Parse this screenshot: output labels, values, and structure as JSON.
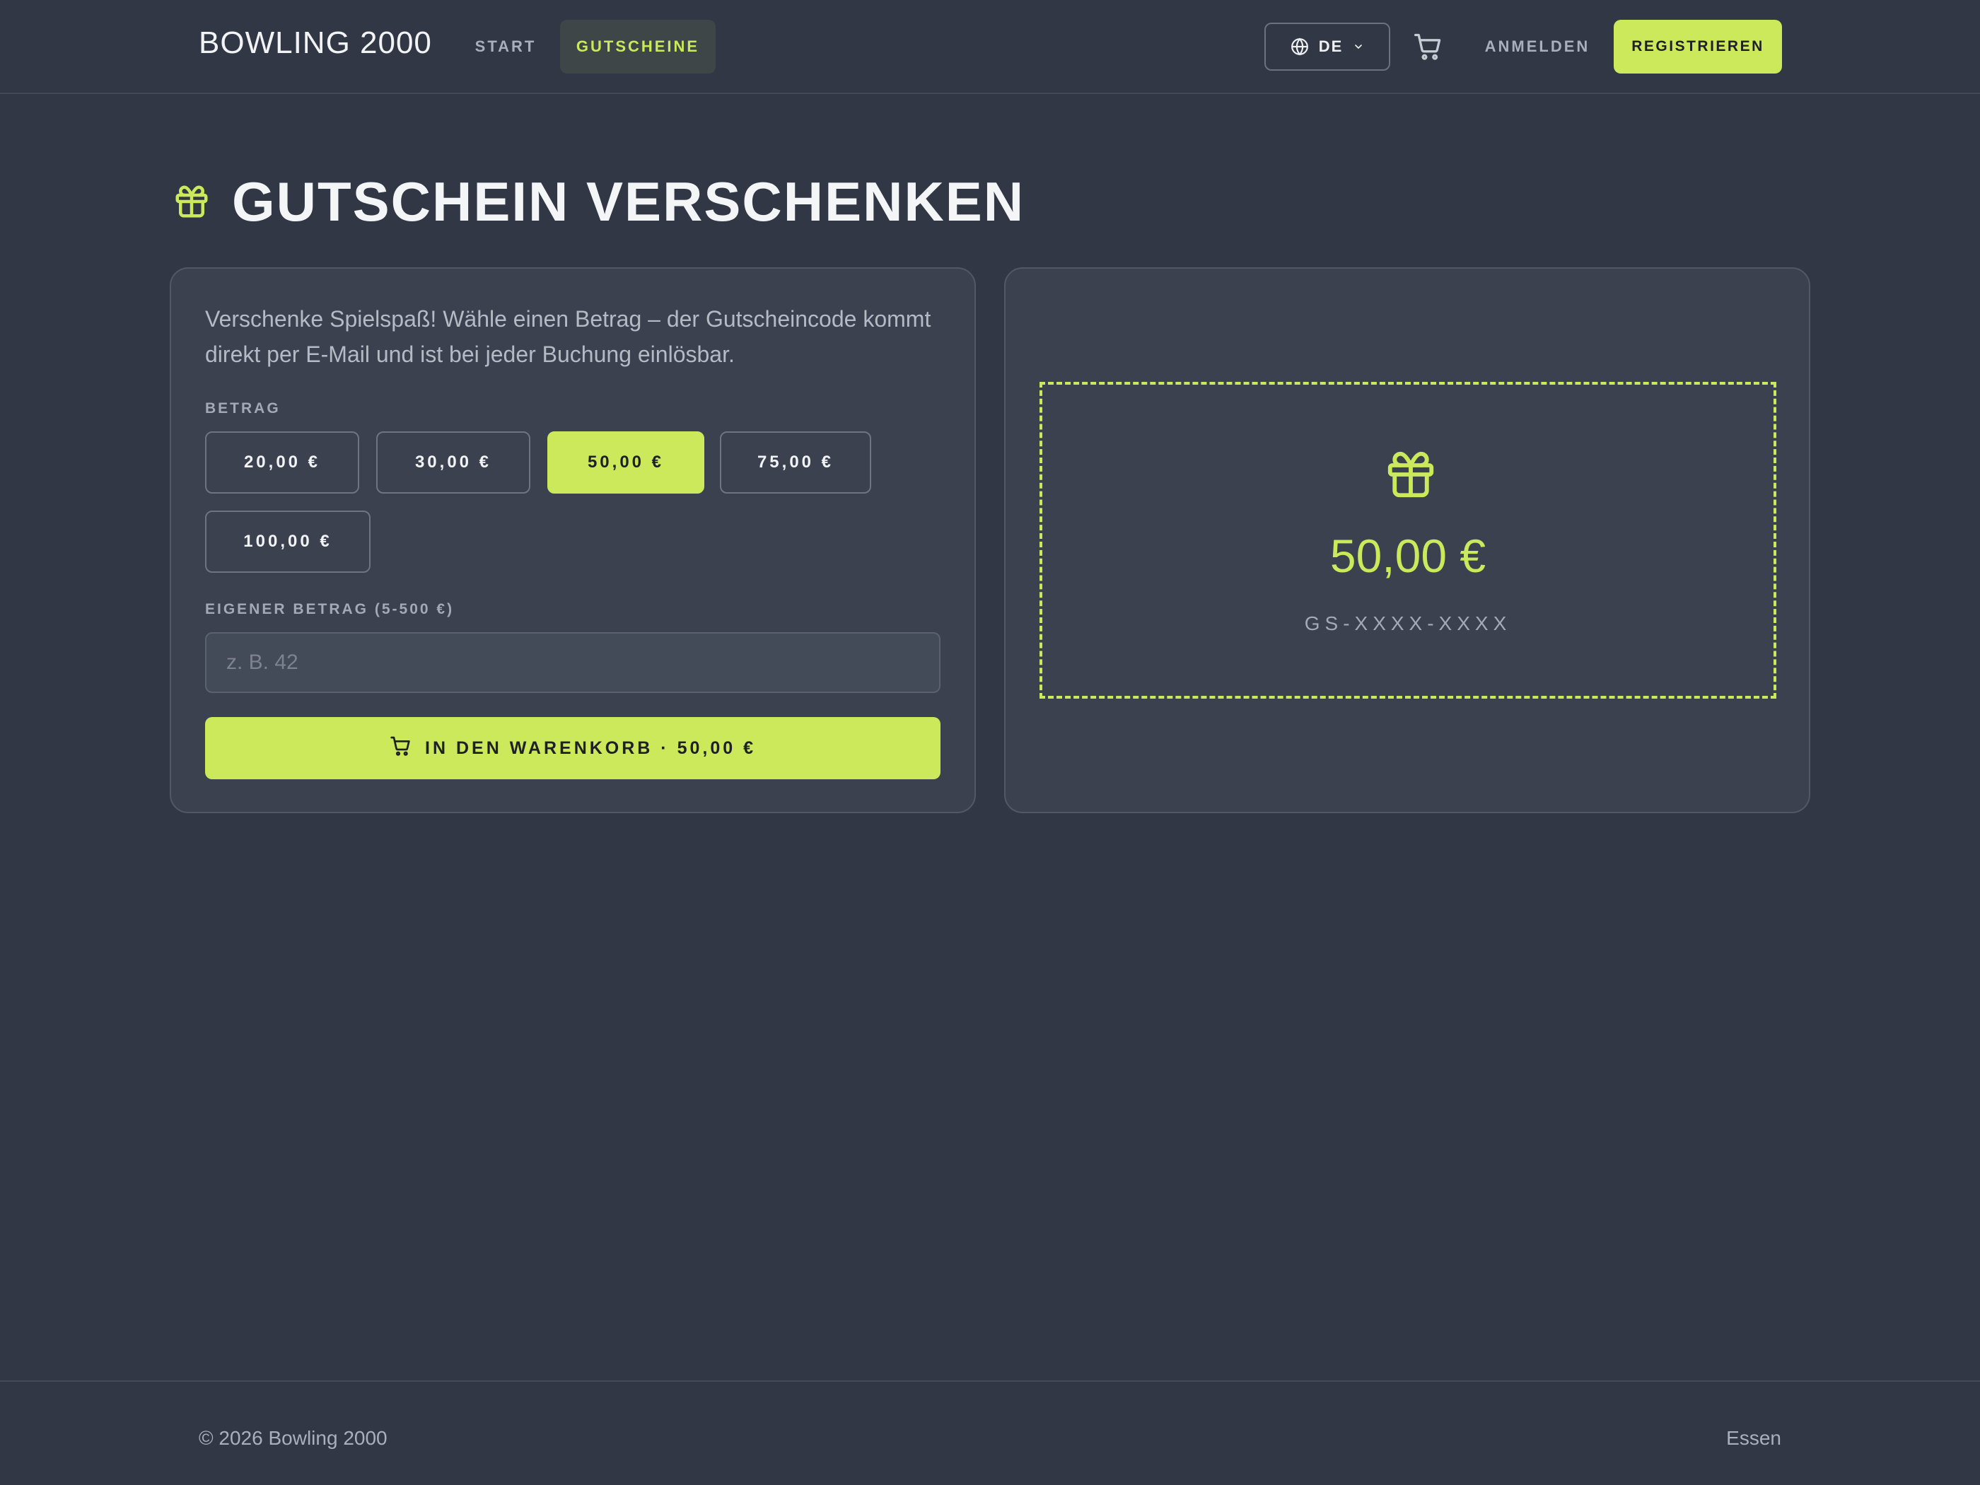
{
  "header": {
    "brand": "BOWLING 2000",
    "nav": [
      {
        "label": "START",
        "active": false
      },
      {
        "label": "GUTSCHEINE",
        "active": true
      }
    ],
    "language": "DE",
    "login_label": "ANMELDEN",
    "register_label": "REGISTRIEREN"
  },
  "page": {
    "title": "GUTSCHEIN VERSCHENKEN"
  },
  "form": {
    "intro": "Verschenke Spielspaß! Wähle einen Betrag – der Gutscheincode kommt direkt per E-Mail und ist bei jeder Buchung einlösbar.",
    "amount_label": "BETRAG",
    "amounts": [
      {
        "label": "20,00 €",
        "selected": false
      },
      {
        "label": "30,00 €",
        "selected": false
      },
      {
        "label": "50,00 €",
        "selected": true
      },
      {
        "label": "75,00 €",
        "selected": false
      },
      {
        "label": "100,00 €",
        "selected": false
      }
    ],
    "custom_label": "EIGENER BETRAG (5-500 €)",
    "custom_placeholder": "z. B. 42",
    "custom_value": "",
    "add_to_cart_label": "IN DEN WARENKORB · 50,00 €"
  },
  "preview": {
    "amount": "50,00 €",
    "code": "GS-XXXX-XXXX"
  },
  "footer": {
    "copyright": "© 2026 Bowling 2000",
    "link": "Essen"
  },
  "colors": {
    "background": "#313744",
    "card": "#3b414f",
    "accent": "#cbe95a",
    "muted_text": "#a9afbb"
  },
  "icons": {
    "language": "globe-icon",
    "language_dropdown": "chevron-down-icon",
    "cart": "cart-icon",
    "title": "gift-icon",
    "voucher": "gift-icon",
    "add_to_cart": "cart-icon"
  }
}
